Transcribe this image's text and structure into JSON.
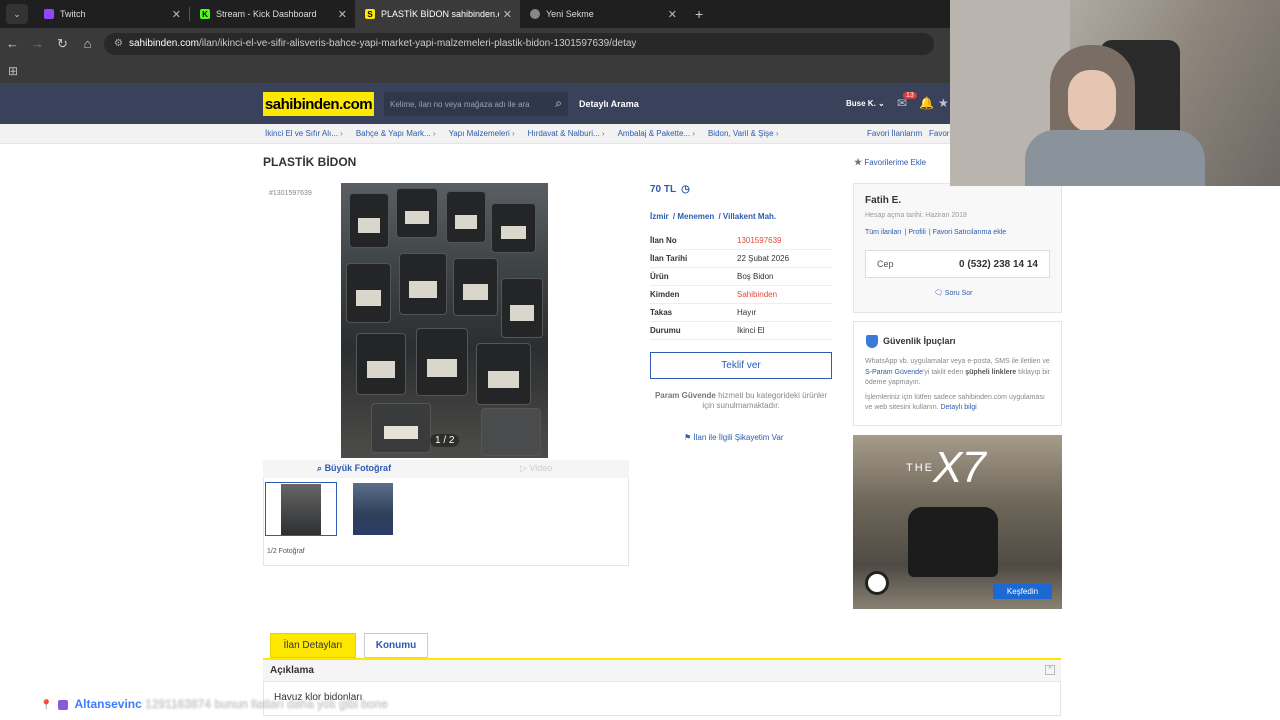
{
  "browser": {
    "tabs": [
      {
        "label": "Twitch",
        "favicon_color": "#9146ff",
        "favicon_glyph": ""
      },
      {
        "label": "Stream - Kick Dashboard",
        "favicon_color": "#53fc18",
        "favicon_glyph": "K"
      },
      {
        "label": "PLASTİK BİDON sahibinden.com",
        "favicon_color": "#ffe800",
        "favicon_glyph": "S"
      },
      {
        "label": "Yeni Sekme",
        "favicon_color": "#888888",
        "favicon_glyph": ""
      }
    ],
    "url_host": "sahibinden.com",
    "url_path": "/ilan/ikinci-el-ve-sifir-alisveris-bahce-yapi-market-yapi-malzemeleri-plastik-bidon-1301597639/detay"
  },
  "header": {
    "logo": "sahibinden.com",
    "search_placeholder": "Kelime, ilan no veya mağaza adı ile ara",
    "detailed_search": "Detaylı Arama",
    "user": "Buse K.",
    "message_count": "13"
  },
  "breadcrumb": [
    "İkinci El ve Sıfır Alı...",
    "Bahçe & Yapı Mark...",
    "Yapı Malzemeleri",
    "Hırdavat & Nalburi...",
    "Ambalaj & Pakette...",
    "Bidon, Varil & Şişe"
  ],
  "breadcrumb_right": {
    "fav_list": "Favori İlanlarım",
    "fav_list2": "Favori"
  },
  "listing": {
    "title": "PLASTİK BİDON",
    "id_label": "#1301597639",
    "favorite_add": "Favorilerime Ekle",
    "photo_counter": "1 / 2",
    "big_photo": "Büyük Fotoğraf",
    "video": "Video",
    "photo_count_label": "1/2 Fotoğraf",
    "price": "70 TL",
    "location": [
      "İzmir",
      "Menemen",
      "Villakent Mah."
    ],
    "info": [
      {
        "key": "İlan No",
        "value": "1301597639",
        "red": true
      },
      {
        "key": "İlan Tarihi",
        "value": "22 Şubat 2026",
        "red": false
      },
      {
        "key": "Ürün",
        "value": "Boş Bidon",
        "red": false
      },
      {
        "key": "Kimden",
        "value": "Sahibinden",
        "red": true
      },
      {
        "key": "Takas",
        "value": "Hayır",
        "red": false
      },
      {
        "key": "Durumu",
        "value": "İkinci El",
        "red": false
      }
    ],
    "offer_button": "Teklif ver",
    "param_note_bold": "Param Güvende",
    "param_note": " hizmeti bu kategorideki ürünler için sunulmamaktadır.",
    "complain": "İlan ile İlgili Şikayetim Var"
  },
  "seller": {
    "name": "Fatih E.",
    "since": "Hesap açma tarihi: Haziran 2018",
    "links": [
      "Tüm ilanları",
      "Profili",
      "Favori Satıcılarıma ekle"
    ],
    "phone_label": "Cep",
    "phone": "0 (532) 238 14 14",
    "ask": "Soru Sor"
  },
  "safety": {
    "title": "Güvenlik İpuçları",
    "p1_a": "WhatsApp vb. uygulamalar veya e-posta, SMS ile iletilen ve ",
    "p1_link": "S-Param Güvende",
    "p1_b": "'yi taklit eden ",
    "p1_bold": "şüpheli linklere",
    "p1_c": " tıklayıp bir ödeme yapmayın.",
    "p2": "İşlemleriniz için lütfen sadece sahibinden.com uygulaması ve web sitesini kullanın. ",
    "p2_link": "Detaylı bilgi"
  },
  "ad": {
    "the": "THE",
    "model": "X7",
    "cta": "Keşfedin"
  },
  "bottom_tabs": {
    "details": "İlan Detayları",
    "location": "Konumu"
  },
  "description": {
    "title": "Açıklama",
    "text": "Havuz klor bidonları"
  },
  "chat": {
    "user": "Altansevinc",
    "message": "1291163874 bunun fiatları daha yok gibi bone"
  }
}
